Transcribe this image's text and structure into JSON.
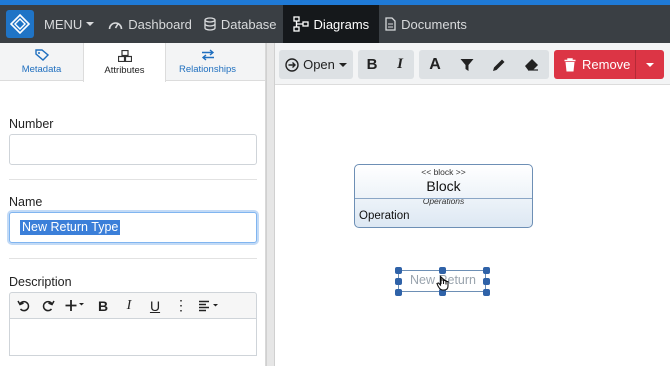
{
  "navbar": {
    "menu_label": "MENU",
    "items": [
      {
        "label": "Dashboard",
        "icon": "dashboard-icon"
      },
      {
        "label": "Database",
        "icon": "database-icon"
      },
      {
        "label": "Diagrams",
        "icon": "diagram-icon",
        "active": true
      },
      {
        "label": "Documents",
        "icon": "document-icon"
      }
    ]
  },
  "left_panel": {
    "tabs": [
      {
        "label": "Metadata",
        "icon": "tag-icon"
      },
      {
        "label": "Attributes",
        "icon": "attributes-icon",
        "active": true
      },
      {
        "label": "Relationships",
        "icon": "relationships-icon"
      }
    ],
    "fields": {
      "number": {
        "label": "Number",
        "value": ""
      },
      "name": {
        "label": "Name",
        "value": "New Return Type"
      },
      "description": {
        "label": "Description",
        "value": ""
      }
    },
    "rte_toolbar": [
      "undo-icon",
      "redo-icon",
      "insert-icon",
      "bold-icon",
      "italic-icon",
      "underline-icon",
      "more-icon",
      "align-icon"
    ]
  },
  "toolbar": {
    "open_label": "Open",
    "remove_label": "Remove",
    "buttons": [
      "bold-icon",
      "italic-icon",
      "font-icon",
      "filter-icon",
      "pencil-icon",
      "eraser-icon"
    ],
    "remove_color": "#dc3545"
  },
  "diagram": {
    "block": {
      "stereotype": "<< block >>",
      "name": "Block",
      "section_title": "Operations",
      "operation": "Operation"
    },
    "new_element_text": "New Return"
  },
  "colors": {
    "navbar": "#3a3f44",
    "accent": "#1f7ad6",
    "link": "#1f6fbf"
  }
}
